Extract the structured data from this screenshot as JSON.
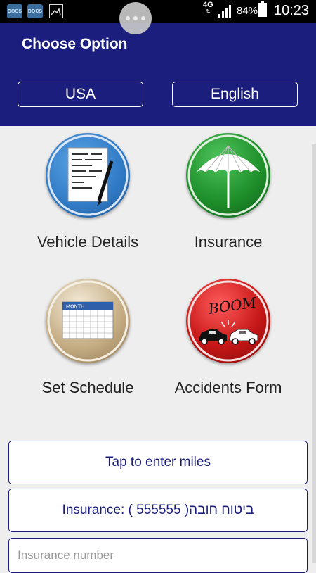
{
  "status_bar": {
    "app_icon_1": "DOCS",
    "app_icon_2": "DOCS",
    "network": "4G",
    "network_arrows": "⇅",
    "battery": "84%",
    "time": "10:23"
  },
  "header": {
    "title": "Choose Option",
    "country_button": "USA",
    "language_button": "English",
    "background_color": "#1b1e7d"
  },
  "tiles": [
    {
      "label": "Vehicle Details",
      "icon": "vehicle-details-icon",
      "color": "#2f79c4"
    },
    {
      "label": "Insurance",
      "icon": "umbrella-icon",
      "color": "#1e8f2a"
    },
    {
      "label": "Set Schedule",
      "icon": "calendar-icon",
      "color": "#c5ad84"
    },
    {
      "label": "Accidents Form",
      "icon": "car-crash-icon",
      "color": "#c41616"
    }
  ],
  "calendar_icon_text": "MONTH",
  "crash_icon_text": "BOOM",
  "miles_button": "Tap to enter miles",
  "insurance_button": "Insurance: ביטוח חובה( 555555 )",
  "insurance_number_placeholder": "Insurance number"
}
